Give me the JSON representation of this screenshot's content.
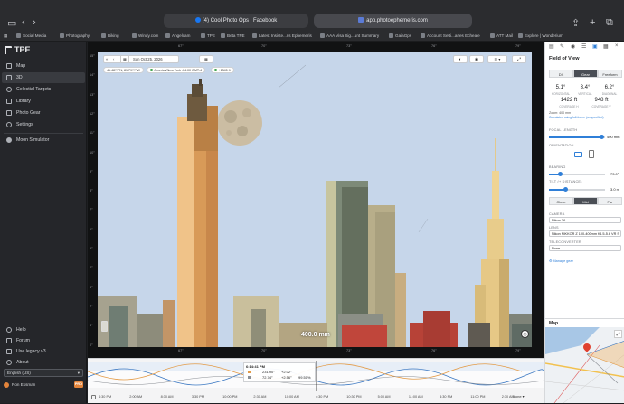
{
  "browser": {
    "tab_facebook": "(4) Cool Photo Ops | Facebook",
    "address": "app.photoephemeris.com",
    "bookmarks": [
      "Social Media",
      "Photography",
      "Biking",
      "Windy.com",
      "Angelcam",
      "TPE",
      "Beta TPE",
      "Latest Insiste...r's Ephemeris",
      "AAA Visa Sig...unt Summary",
      "GaiaGps",
      "Account Setti...aries Echeale",
      "ATT Mail",
      "Explore | Wonderium"
    ]
  },
  "app": {
    "logo_text": "TPE",
    "nav": [
      {
        "label": "Map",
        "icon": "map-icon"
      },
      {
        "label": "3D",
        "icon": "cube-icon"
      },
      {
        "label": "Celestial Targets",
        "icon": "target-icon"
      },
      {
        "label": "Library",
        "icon": "library-icon"
      },
      {
        "label": "Photo Gear",
        "icon": "camera-icon"
      },
      {
        "label": "Settings",
        "icon": "gear-icon"
      }
    ],
    "moon_simulator": "Moon Simulator",
    "bottom_nav": [
      {
        "label": "Help",
        "icon": "help-icon"
      },
      {
        "label": "Forum",
        "icon": "forum-icon"
      },
      {
        "label": "Use legacy v3",
        "icon": "legacy-icon"
      },
      {
        "label": "About",
        "icon": "info-icon"
      }
    ],
    "language": "English (US)",
    "user": "Ron Eksman",
    "pro_badge": "PRO"
  },
  "view": {
    "date": "Sun Oct 25, 2026",
    "coords": "41.48??°N, 81.79??°W",
    "timezone": "America/New York -04:00 GMT-4",
    "elevation": "+1345 ft",
    "focal_overlay": "400.0 mm",
    "top_ticks": [
      "67°",
      "70°",
      "73°",
      "76°",
      "79°"
    ],
    "bottom_ticks": [
      "67°",
      "70°",
      "73°",
      "76°",
      "79°"
    ],
    "left_ticks": [
      "15°",
      "14°",
      "13°",
      "12°",
      "11°",
      "10°",
      "9°",
      "8°",
      "7°",
      "6°",
      "5°",
      "4°",
      "3°",
      "2°",
      "1°",
      "0°"
    ]
  },
  "timeline": {
    "time": "6:14:41 PM",
    "rows": [
      {
        "az": "231.90°",
        "alt": "+2.02°"
      },
      {
        "az": "72.74°",
        "alt": "+2.56°",
        "illum": "99.51%"
      }
    ],
    "times": [
      "4:30 PM",
      "2:00 AM",
      "8:30 AM",
      "3:30 PM",
      "10:00 PM",
      "2:30 AM",
      "10:00 AM",
      "4:30 PM",
      "10:30 PM",
      "5:00 AM",
      "11:00 AM",
      "4:30 PM",
      "11:00 PM",
      "2:30 AM"
    ],
    "zoom_label": "None"
  },
  "panel": {
    "title": "Field of View",
    "tabs": [
      "DX",
      "Gear",
      "Freeform"
    ],
    "fov": [
      {
        "value": "5.1°",
        "label": "Horizontal"
      },
      {
        "value": "3.4°",
        "label": "Vertical"
      },
      {
        "value": "6.2°",
        "label": "Diagonal"
      }
    ],
    "dist": [
      {
        "value": "1422 ft",
        "label": "Coverage H"
      },
      {
        "value": "948 ft",
        "label": "Coverage V"
      }
    ],
    "zoom_note": "Zoom: 400 mm",
    "calc_note": "Calculated using full-frame (unspecified)",
    "focal_length_label": "Focal length",
    "focal_length_value": "400 mm",
    "orientation_label": "Orientation",
    "bearing_label": "Bearing",
    "bearing_value": "73.0°",
    "tilt_label": "Tilt (+ distance)",
    "tilt_value": "3.0 m",
    "range": [
      "Close",
      "Mid",
      "Far"
    ],
    "camera_label": "Camera",
    "camera_value": "Nikon Z6",
    "lens_label": "Lens",
    "lens_value": "Nikon NIKKOR Z 100-400mm f/4.5-5.6 VR S",
    "tele_label": "Teleconverter",
    "tele_value": "None",
    "manage_gear": "Manage gear",
    "map_title": "Map"
  },
  "colors": {
    "sky": "#c9d8ea",
    "tower_lit": "#e8ae6a",
    "moon": "#cfc2a8",
    "accent": "#2f7fd8"
  }
}
